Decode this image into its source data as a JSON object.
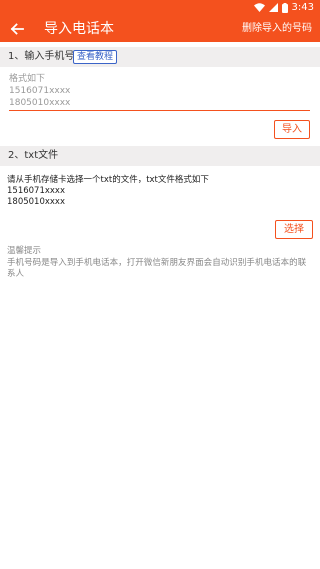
{
  "statusbar": {
    "time": "3:43"
  },
  "appbar": {
    "title": "导入电话本",
    "action": "删除导入的号码"
  },
  "section1": {
    "label": "1、输入手机号",
    "tutorial_button": "查看教程"
  },
  "input": {
    "value": "",
    "placeholder": "格式如下\n1516071xxxx\n1805010xxxx"
  },
  "import_button": "导入",
  "section2": {
    "label": "2、txt文件"
  },
  "txt": {
    "description": "请从手机存储卡选择一个txt的文件，txt文件格式如下\n1516071xxxx\n1805010xxxx"
  },
  "choose_button": "选择",
  "tips": {
    "title": "温馨提示",
    "body": "手机号码是导入到手机电话本，打开微信新朋友界面会自动识别手机电话本的联系人"
  },
  "colors": {
    "primary": "#f4511e",
    "link": "#3b64c8",
    "section_bg": "#f0eeee"
  },
  "icons": [
    "wifi-icon",
    "signal-icon",
    "battery-icon",
    "back-arrow-icon"
  ]
}
